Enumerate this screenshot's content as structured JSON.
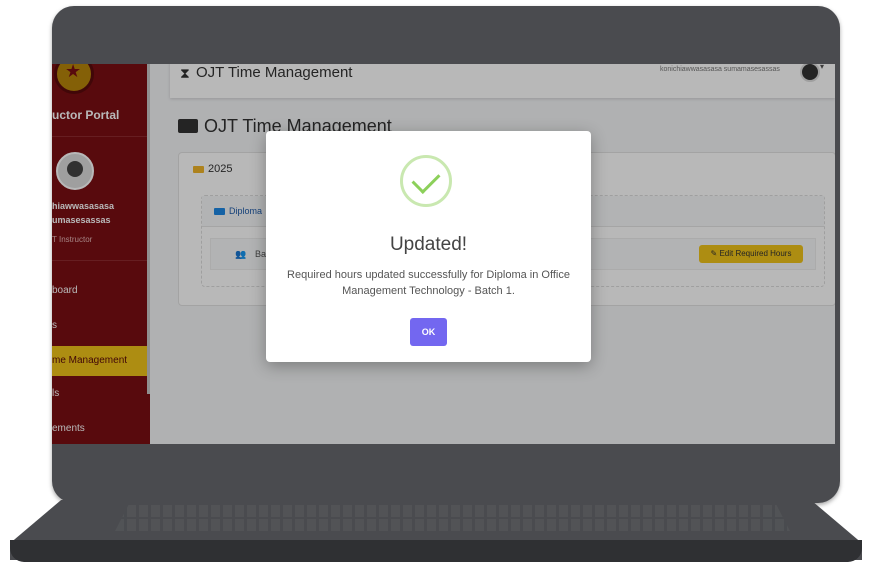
{
  "sidebar": {
    "portal_title": "uctor Portal",
    "user_name_line1": "hiawwasasasa",
    "user_name_line2": "umasesassas",
    "user_role": "T Instructor",
    "items": [
      {
        "label": "board"
      },
      {
        "label": "s"
      },
      {
        "label": "me Management",
        "active": true
      },
      {
        "label": "ls"
      },
      {
        "label": "ements"
      }
    ]
  },
  "topbar": {
    "title": "OJT Time Management",
    "user": "konichiawwasasasa sumamasesassas"
  },
  "page": {
    "title": "OJT Time Management",
    "year": "2025",
    "program": "Diploma",
    "batch": "Ba",
    "edit_button": "Edit Required Hours"
  },
  "modal": {
    "title": "Updated!",
    "message": "Required hours updated successfully for Diploma in Office Management Technology - Batch 1.",
    "ok_label": "OK"
  }
}
